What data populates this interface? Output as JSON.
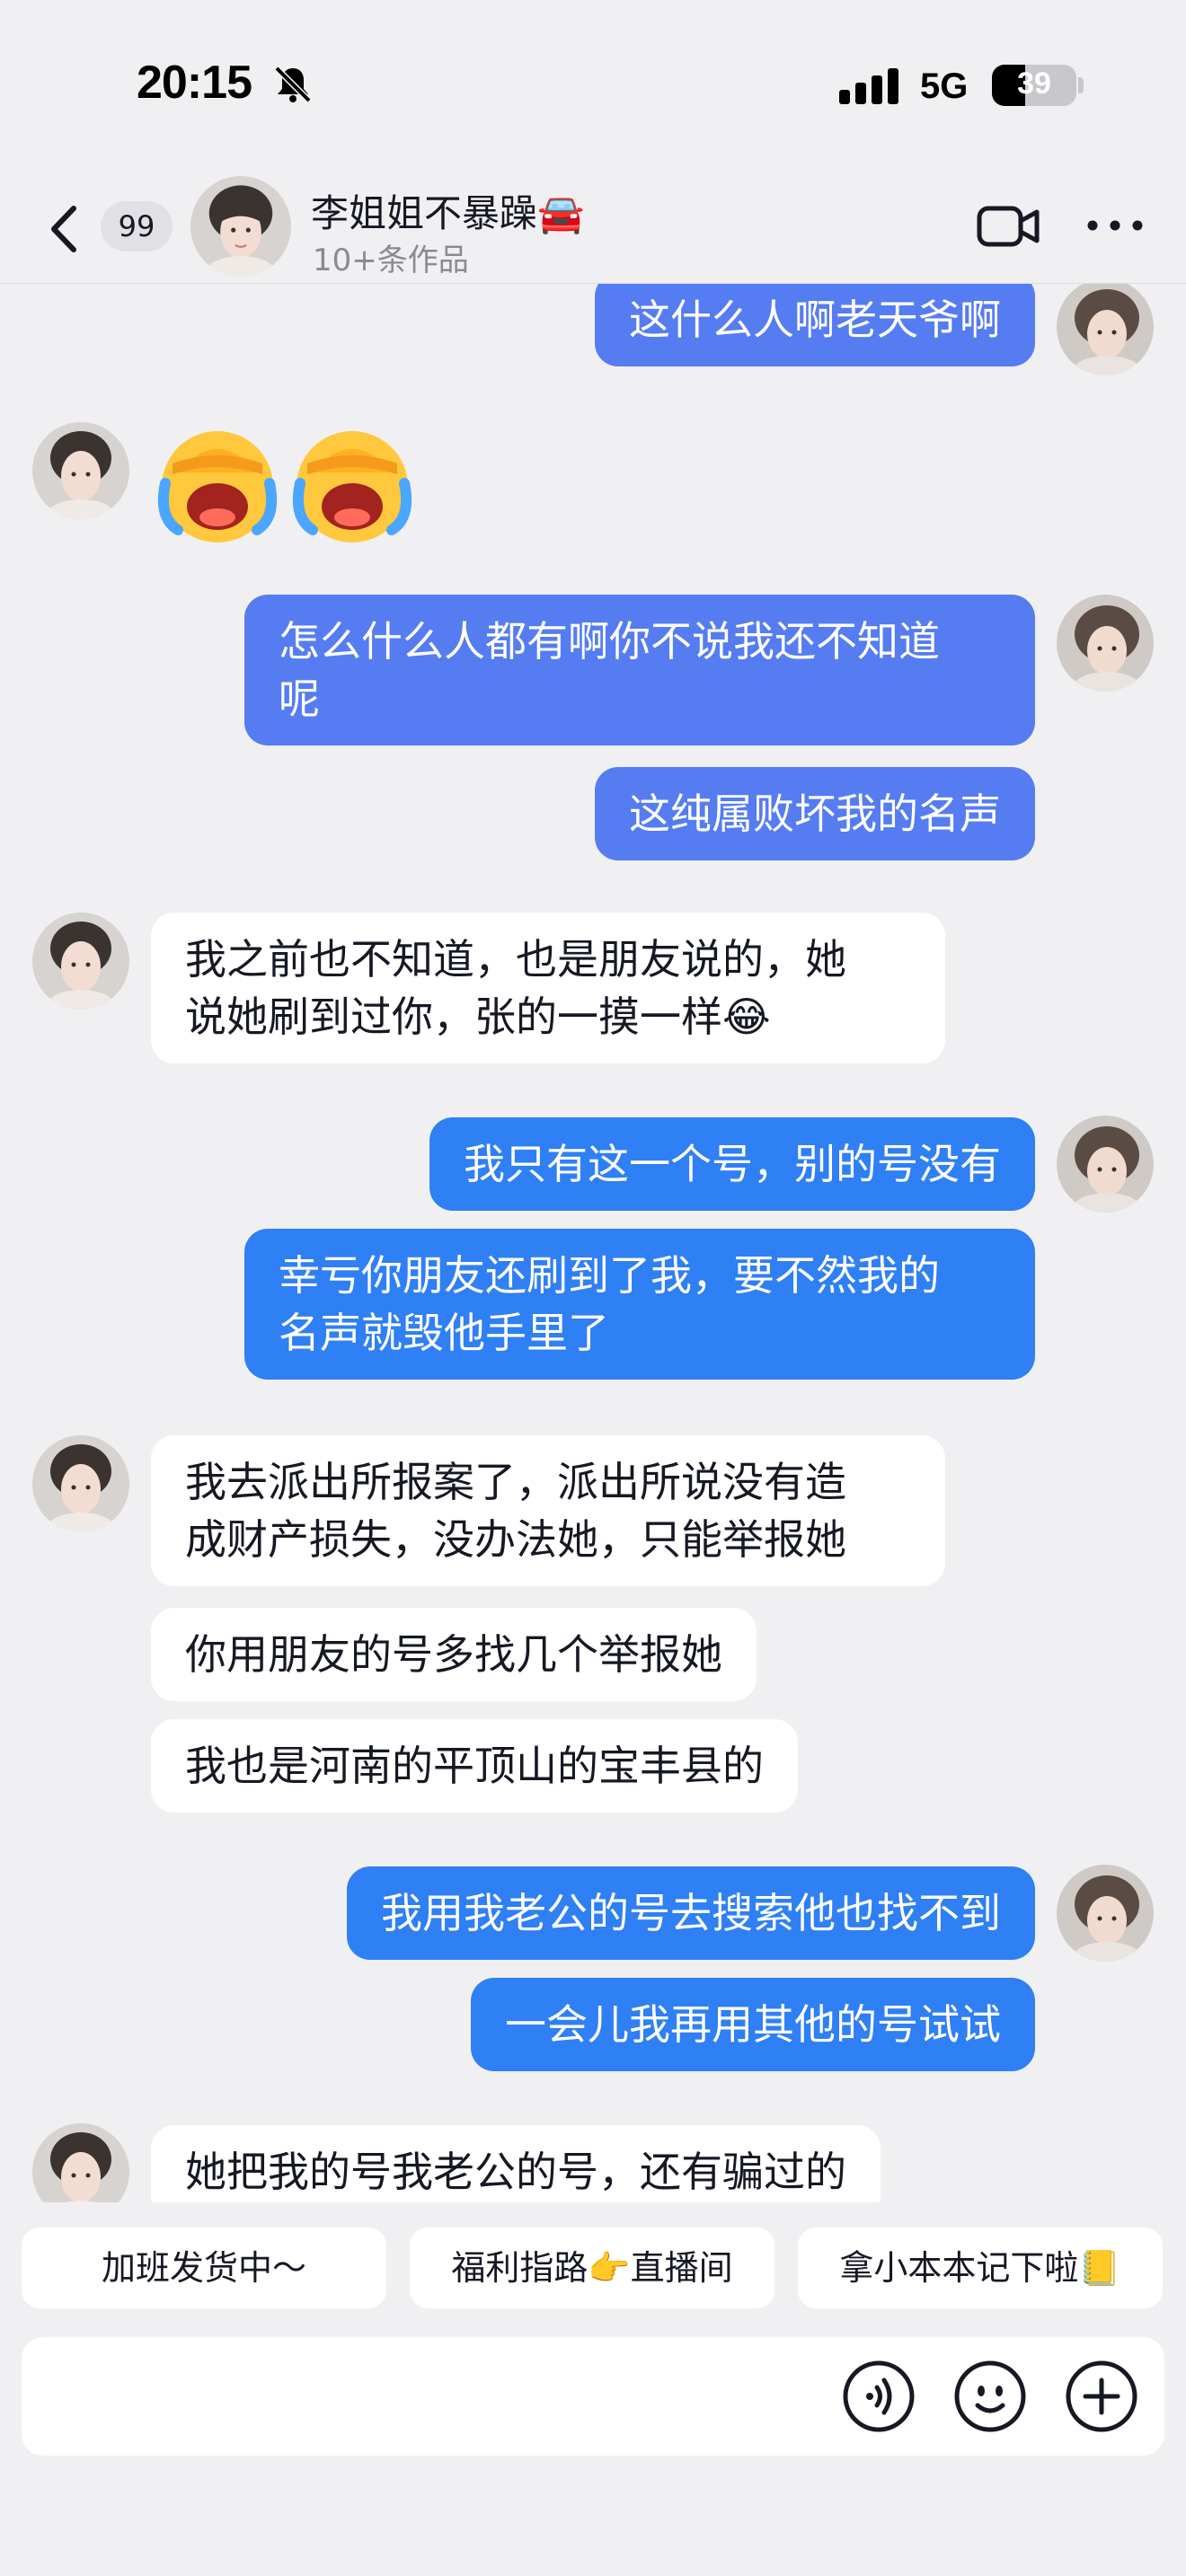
{
  "status_bar": {
    "time": "20:15",
    "network": "5G",
    "battery": "39",
    "battery_level": 0.39
  },
  "header": {
    "unread_count": "99",
    "contact_name": "李姐姐不暴躁🚘",
    "contact_subtitle": "10+条作品"
  },
  "messages": [
    {
      "side": "out",
      "lines": [
        "这什么人啊老天爷啊"
      ]
    },
    {
      "side": "in",
      "type": "emoji",
      "emoji": "face-with-tears-icon"
    },
    {
      "side": "out",
      "lines": [
        "怎么什么人都有啊你不说我还不知道",
        "呢"
      ]
    },
    {
      "side": "out",
      "lines": [
        "这纯属败坏我的名声"
      ]
    },
    {
      "side": "in",
      "lines": [
        "我之前也不知道，也是朋友说的，她",
        "说她刷到过你，张的一摸一样😂"
      ]
    },
    {
      "side": "out",
      "lines": [
        "我只有这一个号，别的号没有"
      ]
    },
    {
      "side": "out",
      "lines": [
        "幸亏你朋友还刷到了我，要不然我的",
        "名声就毁他手里了"
      ]
    },
    {
      "side": "in",
      "lines": [
        "我去派出所报案了，派出所说没有造",
        "成财产损失，没办法她，只能举报她"
      ]
    },
    {
      "side": "in",
      "lines": [
        "你用朋友的号多找几个举报她"
      ]
    },
    {
      "side": "in",
      "lines": [
        "我也是河南的平顶山的宝丰县的"
      ]
    },
    {
      "side": "out",
      "lines": [
        "我用我老公的号去搜索他也找不到"
      ]
    },
    {
      "side": "out",
      "lines": [
        "一会儿我再用其他的号试试"
      ]
    },
    {
      "side": "in",
      "lines": [
        "她把我的号我老公的号，还有骗过的"
      ]
    }
  ],
  "quick_replies": [
    "加班发货中～",
    "福利指路👉直播间",
    "拿小本本记下啦📒"
  ],
  "input": {
    "placeholder": ""
  },
  "colors": {
    "background": "#f0f0f2",
    "outgoing_bubble": "#567cf2",
    "outgoing_bubble_bright": "#2f7ff5",
    "incoming_bubble": "#ffffff"
  }
}
